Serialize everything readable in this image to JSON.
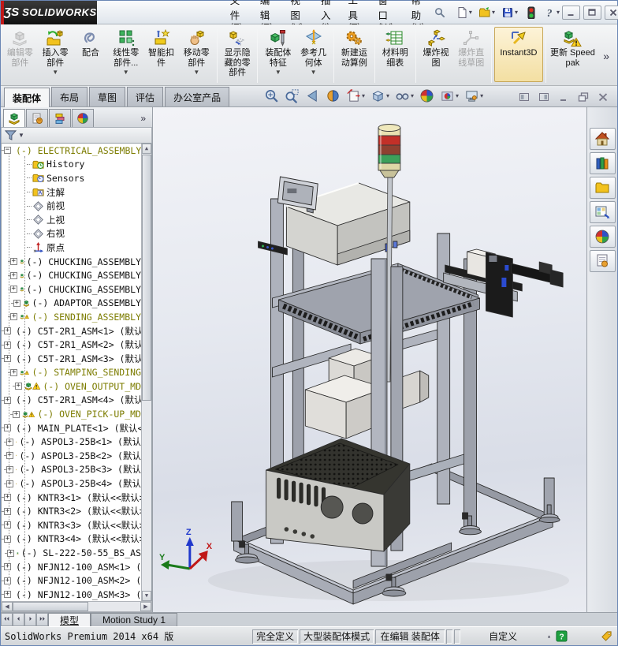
{
  "titlebar": {
    "logo_mark": "ƷS",
    "logo_text": "SOLIDWORKS",
    "menus": [
      "文件(F)",
      "编辑(E)",
      "视图(V)",
      "插入(I)",
      "工具(T)",
      "窗口(W)",
      "帮助(H)"
    ],
    "quick_tools": [
      {
        "name": "new-document",
        "icon": "t-new",
        "arrow": true
      },
      {
        "name": "open",
        "icon": "t-open",
        "arrow": true
      },
      {
        "name": "save",
        "icon": "t-save",
        "arrow": true
      },
      {
        "name": "rebuild",
        "icon": "t-rebuild",
        "arrow": false
      },
      {
        "name": "help",
        "icon": "t-help",
        "arrow": true
      }
    ],
    "window_buttons": [
      {
        "name": "minimize",
        "icon": "w-min"
      },
      {
        "name": "maximize",
        "icon": "w-max"
      },
      {
        "name": "close",
        "icon": "w-close"
      }
    ]
  },
  "ribbon": {
    "overflow": "»",
    "buttons": [
      {
        "label": "编辑零部件",
        "icon": "r-edit",
        "disabled": true
      },
      {
        "label": "插入零部件",
        "icon": "r-insert",
        "arrow": true
      },
      {
        "label": "配合",
        "icon": "r-mate"
      },
      {
        "label": "线性零部件...",
        "icon": "r-linear",
        "arrow": true
      },
      {
        "label": "智能扣件",
        "icon": "r-smart"
      },
      {
        "label": "移动零部件",
        "icon": "r-move",
        "arrow": true
      },
      {
        "sep": true
      },
      {
        "label": "显示隐藏的零部件",
        "icon": "r-showhide"
      },
      {
        "sep": true
      },
      {
        "label": "装配体特征",
        "icon": "r-asmfeat",
        "arrow": true
      },
      {
        "label": "参考几何体",
        "icon": "r-refgeo",
        "arrow": true
      },
      {
        "sep": true
      },
      {
        "label": "新建运动算例",
        "icon": "r-motion"
      },
      {
        "sep": true
      },
      {
        "label": "材料明细表",
        "icon": "r-bom"
      },
      {
        "sep": true
      },
      {
        "label": "爆炸视图",
        "icon": "r-explode"
      },
      {
        "label": "爆炸直线草图",
        "icon": "r-expsketch",
        "disabled": true
      },
      {
        "sep": true
      },
      {
        "label": "Instant3D",
        "icon": "r-instant3d",
        "active": true,
        "wide": true
      },
      {
        "sep": true
      },
      {
        "label": "更新 Speedpak",
        "icon": "r-speedpak",
        "wide": true
      }
    ]
  },
  "command_tabs": [
    {
      "label": "装配体",
      "active": true
    },
    {
      "label": "布局",
      "active": false
    },
    {
      "label": "草图",
      "active": false
    },
    {
      "label": "评估",
      "active": false
    },
    {
      "label": "办公室产品",
      "active": false
    }
  ],
  "headsup": [
    {
      "name": "zoom-to-fit",
      "icon": "h-zoomfit"
    },
    {
      "name": "zoom-to-area",
      "icon": "h-zoomarea"
    },
    {
      "name": "previous-view",
      "icon": "h-prev"
    },
    {
      "name": "section-view",
      "icon": "h-section"
    },
    {
      "name": "view-orientation",
      "icon": "h-orient",
      "arrow": true
    },
    {
      "name": "display-style",
      "icon": "h-cube",
      "arrow": true
    },
    {
      "name": "hide-show-items",
      "icon": "h-glasses",
      "arrow": true
    },
    {
      "name": "edit-appearance",
      "icon": "h-ball"
    },
    {
      "name": "apply-scene",
      "icon": "h-scene",
      "arrow": true
    },
    {
      "name": "view-settings",
      "icon": "h-monitor",
      "arrow": true
    }
  ],
  "doc_window_buttons": [
    {
      "name": "collapse-pane-left",
      "icon": "d-paneL"
    },
    {
      "name": "collapse-pane-right",
      "icon": "d-paneR"
    },
    {
      "name": "doc-minimize",
      "icon": "d-min"
    },
    {
      "name": "doc-restore",
      "icon": "d-restore"
    },
    {
      "name": "doc-close",
      "icon": "d-close"
    }
  ],
  "feature_panel": {
    "overflow": "»",
    "tabs": [
      {
        "name": "featuremanager-tab",
        "icon": "s-assembly",
        "active": true
      },
      {
        "name": "propertymanager-tab",
        "icon": "p-prop",
        "active": false
      },
      {
        "name": "configurationmanager-tab",
        "icon": "p-config",
        "active": false
      },
      {
        "name": "displaymanager-tab",
        "icon": "h-ball",
        "active": false
      }
    ],
    "tree": [
      {
        "label": "(-) ELECTRICAL_ASSEMBLY",
        "icon": "assembly",
        "level": 0,
        "expander": "minus",
        "warning": true
      },
      {
        "label": "History",
        "icon": "folder-history",
        "level": 2
      },
      {
        "label": "Sensors",
        "icon": "folder-sensors",
        "level": 2
      },
      {
        "label": "注解",
        "icon": "folder-annotations",
        "level": 2
      },
      {
        "label": "前视",
        "icon": "plane",
        "level": 2
      },
      {
        "label": "上视",
        "icon": "plane",
        "level": 2
      },
      {
        "label": "右视",
        "icon": "plane",
        "level": 2
      },
      {
        "label": "原点",
        "icon": "origin",
        "level": 2
      },
      {
        "label": "(-) CHUCKING_ASSEMBLY",
        "icon": "assembly",
        "level": 1,
        "expander": "plus"
      },
      {
        "label": "(-) CHUCKING_ASSEMBLY",
        "icon": "assembly",
        "level": 1,
        "expander": "plus"
      },
      {
        "label": "(-) CHUCKING_ASSEMBLY",
        "icon": "assembly",
        "level": 1,
        "expander": "plus"
      },
      {
        "label": "(-) ADAPTOR_ASSEMBLY",
        "icon": "assembly",
        "level": 1,
        "expander": "plus"
      },
      {
        "label": "(-) SENDING_ASSEMBLY",
        "icon": "assembly",
        "level": 1,
        "expander": "plus",
        "warning": true
      },
      {
        "label": "(-) C5T-2R1_ASM<1> (默认",
        "icon": "assembly",
        "level": 1,
        "expander": "plus"
      },
      {
        "label": "(-) C5T-2R1_ASM<2> (默认",
        "icon": "assembly",
        "level": 1,
        "expander": "plus"
      },
      {
        "label": "(-) C5T-2R1_ASM<3> (默认",
        "icon": "assembly",
        "level": 1,
        "expander": "plus"
      },
      {
        "label": "(-) STAMPING_SENDING",
        "icon": "assembly",
        "level": 1,
        "expander": "plus",
        "warning": true
      },
      {
        "label": "(-) OVEN_OUTPUT_MD",
        "icon": "assembly",
        "level": 1,
        "expander": "plus",
        "warning": true
      },
      {
        "label": "(-) C5T-2R1_ASM<4> (默认",
        "icon": "assembly",
        "level": 1,
        "expander": "plus"
      },
      {
        "label": "(-) OVEN_PICK-UP_MD",
        "icon": "assembly",
        "level": 1,
        "expander": "plus",
        "warning": true
      },
      {
        "label": "(-) MAIN_PLATE<1> (默认<<",
        "icon": "part",
        "level": 1,
        "expander": "plus"
      },
      {
        "label": "(-) ASPOL3-25B<1> (默认",
        "icon": "part",
        "level": 1,
        "expander": "plus"
      },
      {
        "label": "(-) ASPOL3-25B<2> (默认",
        "icon": "part",
        "level": 1,
        "expander": "plus"
      },
      {
        "label": "(-) ASPOL3-25B<3> (默认",
        "icon": "part",
        "level": 1,
        "expander": "plus"
      },
      {
        "label": "(-) ASPOL3-25B<4> (默认",
        "icon": "part",
        "level": 1,
        "expander": "plus"
      },
      {
        "label": "(-) KNTR3<1> (默认<<默认>",
        "icon": "part",
        "level": 1,
        "expander": "plus"
      },
      {
        "label": "(-) KNTR3<2> (默认<<默认>",
        "icon": "part",
        "level": 1,
        "expander": "plus"
      },
      {
        "label": "(-) KNTR3<3> (默认<<默认>",
        "icon": "part",
        "level": 1,
        "expander": "plus"
      },
      {
        "label": "(-) KNTR3<4> (默认<<默认>",
        "icon": "part",
        "level": 1,
        "expander": "plus"
      },
      {
        "label": "(-) SL-222-50-55_BS_AS",
        "icon": "assembly",
        "level": 1,
        "expander": "plus"
      },
      {
        "label": "(-) NFJN12-100_ASM<1> (",
        "icon": "assembly",
        "level": 1,
        "expander": "plus"
      },
      {
        "label": "(-) NFJN12-100_ASM<2> (",
        "icon": "assembly",
        "level": 1,
        "expander": "plus"
      },
      {
        "label": "(-) NFJN12-100_ASM<3> (",
        "icon": "assembly",
        "level": 1,
        "expander": "plus"
      }
    ]
  },
  "task_pane": [
    {
      "name": "solidworks-resources",
      "icon": "k-home"
    },
    {
      "name": "design-library",
      "icon": "k-lib"
    },
    {
      "name": "file-explorer",
      "icon": "k-folder"
    },
    {
      "name": "view-palette",
      "icon": "k-palette"
    },
    {
      "name": "appearances-scenes",
      "icon": "h-ball"
    },
    {
      "name": "custom-properties",
      "icon": "k-custom"
    }
  ],
  "model_tabs": {
    "nav": [
      "⏴⏴",
      "⏴",
      "⏵",
      "⏵⏵"
    ],
    "tabs": [
      {
        "label": "模型",
        "active": true
      },
      {
        "label": "Motion Study 1",
        "active": false
      }
    ]
  },
  "status_bar": {
    "left": "SolidWorks Premium 2014 x64 版",
    "cells": [
      "完全定义",
      "大型装配体模式",
      "在编辑 装配体",
      "",
      ""
    ],
    "custom": "自定义",
    "custom_arrow": "▴"
  },
  "viewport": {
    "triad": {
      "x": "X",
      "y": "Y",
      "z": "Z"
    },
    "colors": {
      "tower_red": "#c23028",
      "tower_green": "#3da05a",
      "tower_maroon": "#8f4030",
      "accent_red": "#c01818"
    }
  }
}
